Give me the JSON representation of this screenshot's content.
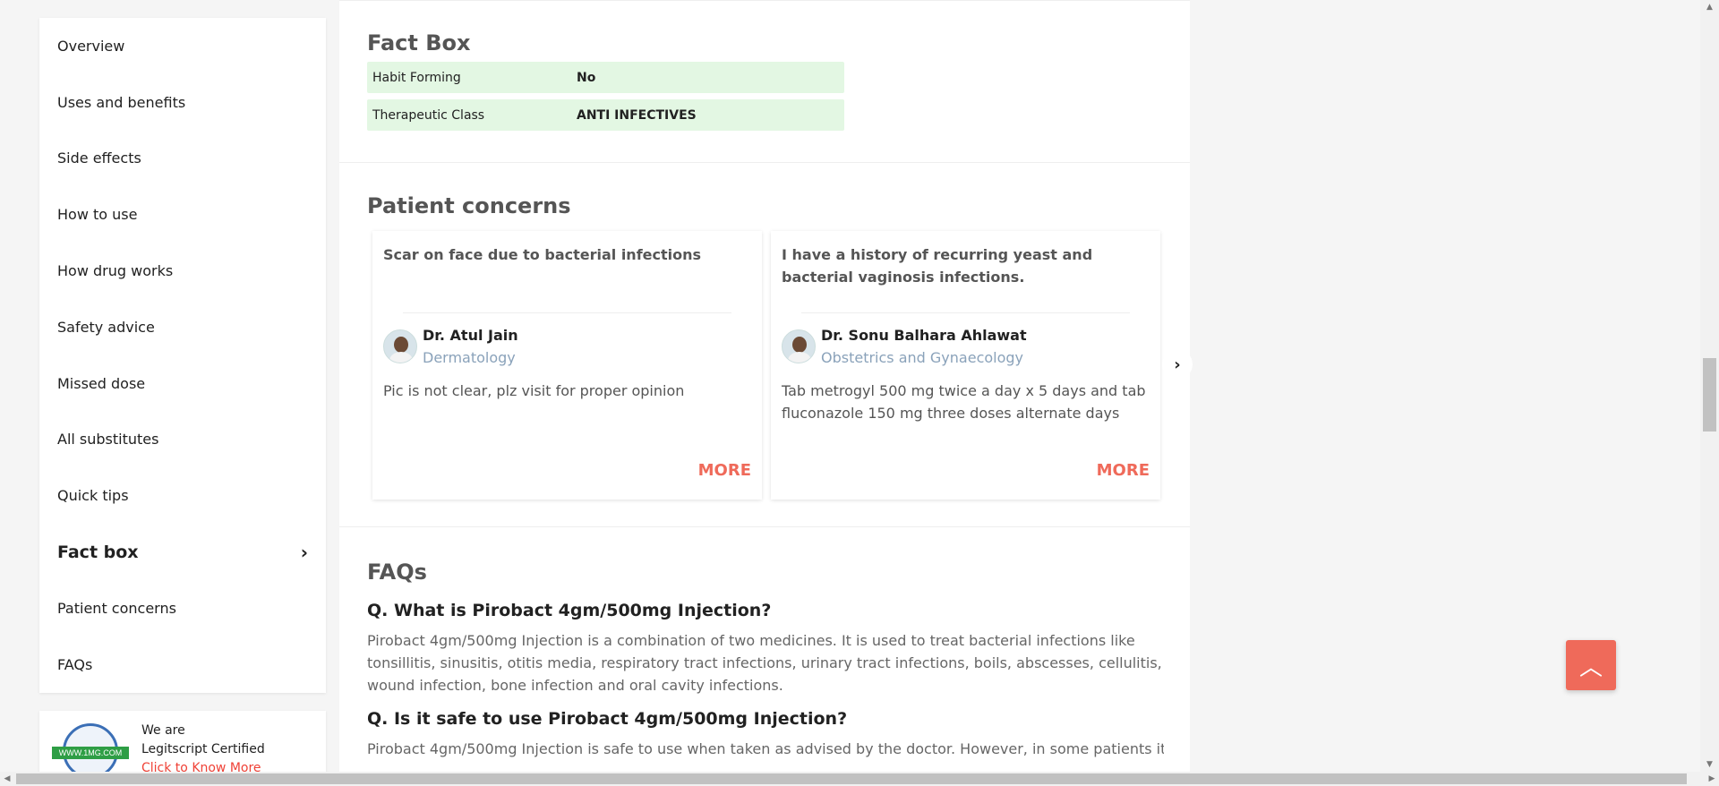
{
  "sidebar": {
    "items": [
      {
        "label": "Overview"
      },
      {
        "label": "Uses and benefits"
      },
      {
        "label": "Side effects"
      },
      {
        "label": "How to use"
      },
      {
        "label": "How drug works"
      },
      {
        "label": "Safety advice"
      },
      {
        "label": "Missed dose"
      },
      {
        "label": "All substitutes"
      },
      {
        "label": "Quick tips"
      },
      {
        "label": "Fact box",
        "active": true
      },
      {
        "label": "Patient concerns"
      },
      {
        "label": "FAQs"
      }
    ],
    "active_icon": "chevron-right-icon"
  },
  "legitscript": {
    "seal_text": "WWW.1MG.COM",
    "line1": "We are",
    "line2": "Legitscript Certified",
    "link": "Click to Know More"
  },
  "fact_box": {
    "title": "Fact Box",
    "rows": [
      {
        "key": "Habit Forming",
        "value": "No"
      },
      {
        "key": "Therapeutic Class",
        "value": "ANTI INFECTIVES"
      }
    ]
  },
  "patient_concerns": {
    "title": "Patient concerns",
    "cards": [
      {
        "question": "Scar on face due to bacterial infections",
        "doctor": "Dr. Atul Jain",
        "specialty": "Dermatology",
        "answer": "Pic is not clear, plz visit for proper opinion",
        "more": "MORE"
      },
      {
        "question": "I have a history of recurring yeast and bacterial vaginosis infections.",
        "doctor": "Dr. Sonu Balhara Ahlawat",
        "specialty": "Obstetrics and Gynaecology",
        "answer": "Tab metrogyl 500 mg twice a day x 5 days and tab fluconazole 150 mg three doses alternate days",
        "more": "MORE"
      }
    ],
    "next_icon": "chevron-right-icon"
  },
  "faqs": {
    "title": "FAQs",
    "items": [
      {
        "q": "Q. What is Pirobact 4gm/500mg Injection?",
        "a": "Pirobact 4gm/500mg Injection is a combination of two medicines. It is used to treat bacterial infections like tonsillitis, sinusitis, otitis media, respiratory tract infections, urinary tract infections, boils, abscesses, cellulitis, wound infection, bone infection and oral cavity infections."
      },
      {
        "q": "Q. Is it safe to use Pirobact 4gm/500mg Injection?",
        "a": "Pirobact 4gm/500mg Injection is safe to use when taken as advised by the doctor. However, in some patients it"
      }
    ]
  },
  "scroll_top_icon": "chevron-up-icon",
  "colors": {
    "accent": "#ef6a5a",
    "fact_row_bg": "#e3f7e3",
    "specialty": "#8aa2ba"
  }
}
